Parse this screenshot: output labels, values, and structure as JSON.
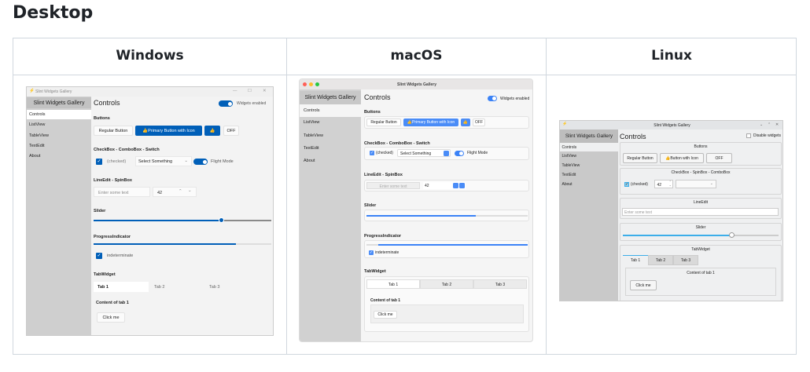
{
  "heading": "Desktop",
  "columns": [
    "Windows",
    "macOS",
    "Linux"
  ],
  "app_title": "Slint Widgets Gallery",
  "sidebar": [
    "Controls",
    "ListView",
    "TableView",
    "TextEdit",
    "About"
  ],
  "page_title": "Controls",
  "windows": {
    "toggle_label": "Widgets enabled",
    "buttons_label": "Buttons",
    "regular": "Regular Button",
    "primary": "Primary Button with Icon",
    "thumb": "👍",
    "off": "OFF",
    "check_label": "CheckBox - ComboBox - Switch",
    "checked": "(checked)",
    "combo": "Select Something",
    "switch": "Flight Mode",
    "lineedit_label": "LineEdit - SpinBox",
    "placeholder": "Enter some text",
    "spin": "42",
    "slider_label": "Slider",
    "slider_value": 0.72,
    "progress_label": "ProgressIndicator",
    "progress_value": 0.8,
    "indeterminate": "indeterminate",
    "tab_label": "TabWidget",
    "tabs": [
      "Tab 1",
      "Tab 2",
      "Tab 3"
    ],
    "content": "Content of tab 1",
    "click": "Click me"
  },
  "macos": {
    "toggle_label": "Widgets enabled",
    "buttons_label": "Buttons",
    "regular": "Regular Button",
    "primary": "Primary Button with Icon",
    "thumb": "👍",
    "off": "OFF",
    "check_label": "CheckBox - ComboBox - Switch",
    "checked": "(checked)",
    "combo": "Select Something",
    "switch": "Flight Mode",
    "lineedit_label": "LineEdit - SpinBox",
    "placeholder": "Enter some text",
    "spin": "42",
    "slider_label": "Slider",
    "slider_value": 0.68,
    "progress_label": "ProgressIndicator",
    "indeterminate": "indeterminate",
    "tab_label": "TabWidget",
    "tabs": [
      "Tab 1",
      "Tab 2",
      "Tab 3"
    ],
    "content": "Content of tab 1",
    "click": "Click me"
  },
  "linux": {
    "disable_label": "Disable widgets",
    "buttons_label": "Buttons",
    "regular": "Regular Button",
    "icon_button": "Button with Icon",
    "thumb": "👍",
    "off": "OFF",
    "check_label": "CheckBox - SpinBox - ComboBox",
    "checked": "(checked)",
    "spin": "42",
    "lineedit_label": "LineEdit",
    "placeholder": "Enter some text",
    "slider_label": "Slider",
    "slider_value": 0.7,
    "tab_label": "TabWidget",
    "tabs": [
      "Tab 1",
      "Tab 2",
      "Tab 3"
    ],
    "content": "Content of tab 1",
    "click": "Click me"
  },
  "colors": {
    "win_accent": "#005fb8",
    "mac_accent": "#3b82f6",
    "linux_accent": "#3daee9"
  }
}
